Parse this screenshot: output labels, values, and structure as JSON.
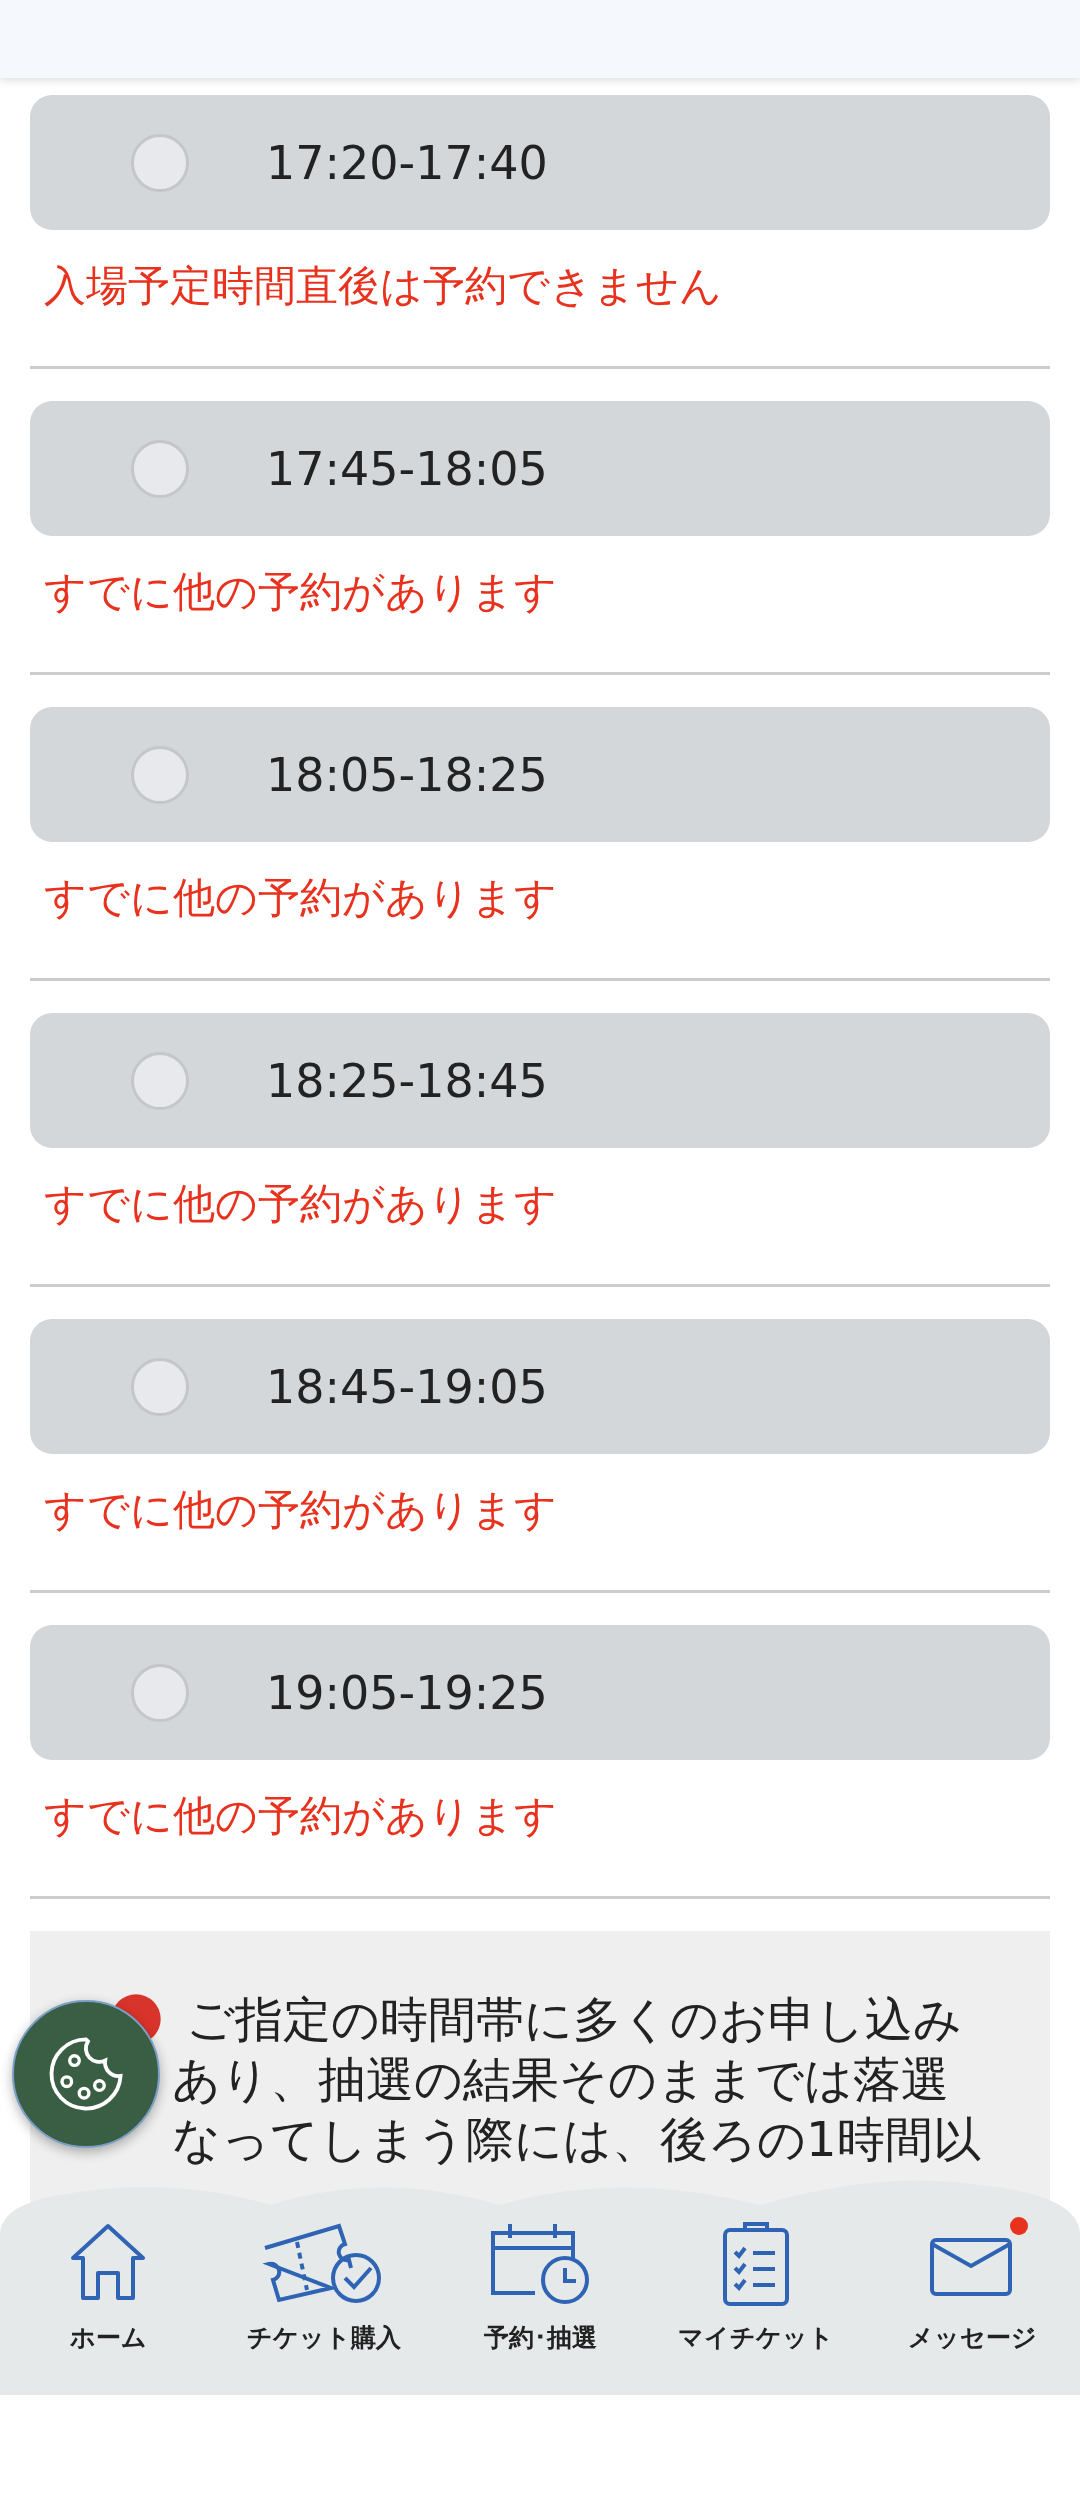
{
  "slots": [
    {
      "time": "17:20-17:40",
      "selected": false,
      "disabled": true,
      "message": "入場予定時間直後は予約できません"
    },
    {
      "time": "17:45-18:05",
      "selected": false,
      "disabled": true,
      "message": "すでに他の予約があります"
    },
    {
      "time": "18:05-18:25",
      "selected": false,
      "disabled": true,
      "message": "すでに他の予約があります"
    },
    {
      "time": "18:25-18:45",
      "selected": false,
      "disabled": true,
      "message": "すでに他の予約があります"
    },
    {
      "time": "18:45-19:05",
      "selected": false,
      "disabled": true,
      "message": "すでに他の予約があります"
    },
    {
      "time": "19:05-19:25",
      "selected": false,
      "disabled": true,
      "message": "すでに他の予約があります"
    }
  ],
  "notice": {
    "lines": [
      "ご指定の時間帯に多くのお申し込み",
      "あり、抽選の結果そのままでは落選",
      "なってしまう際には、後ろの1時間以"
    ]
  },
  "tabs": [
    {
      "kind": "home",
      "label": "ホーム",
      "badge": false
    },
    {
      "kind": "ticket",
      "label": "チケット購入",
      "badge": false
    },
    {
      "kind": "calendar",
      "label": "予約･抽選",
      "badge": false
    },
    {
      "kind": "list",
      "label": "マイチケット",
      "badge": false
    },
    {
      "kind": "mail",
      "label": "メッセージ",
      "badge": true
    }
  ]
}
